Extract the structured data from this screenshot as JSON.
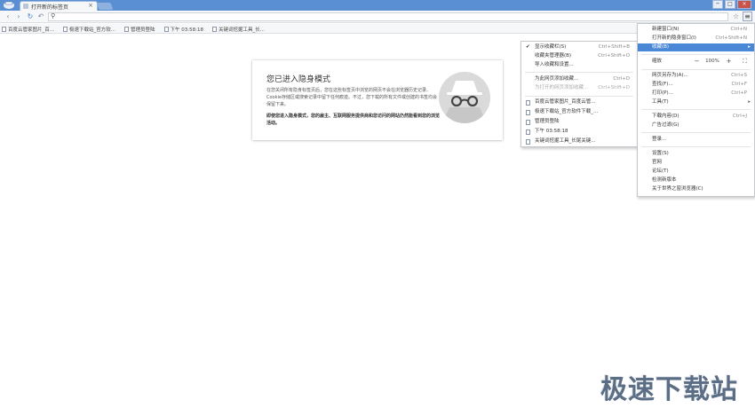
{
  "window": {
    "tab_title": "打开新的标签页",
    "tab_close": "×",
    "new_tab": "",
    "controls": [
      "─",
      "□",
      "×"
    ]
  },
  "toolbar": {
    "back": "‹",
    "forward": "›",
    "reload": "↻",
    "undo": "↶",
    "search_glyph": "⚲",
    "omnibox_value": "",
    "star_glyph": "☆",
    "menu_glyph": "≡"
  },
  "bookmarks_bar": [
    "百度云管家图片_百...",
    "极速下载站_官方软...",
    "管理员登陆",
    "下午 03:58:18",
    "关键词挖掘工具_长..."
  ],
  "incognito": {
    "title": "您已进入隐身模式",
    "paragraph": "在您关闭所有隐身标签页后，您在这些标签页中浏览的网页不会在浏览器历史记录、Cookie存储区或搜索记录中留下任何痕迹。不过，您下载的所有文件或创建的书签均会保留下来。",
    "warning": "即使您进入隐身模式，您的雇主、互联网服务提供商和您访问的网站仍然能看到您的浏览活动。"
  },
  "bookmarks_menu": {
    "items": [
      {
        "label": "显示收藏栏(S)",
        "shortcut": "Ctrl+Shift+B",
        "checked": true
      },
      {
        "label": "收藏夹管理器(B)",
        "shortcut": "Ctrl+Shift+O"
      },
      {
        "label": "导入收藏和设置..."
      },
      {
        "label": "为此网页添加收藏...",
        "shortcut": "Ctrl+D"
      },
      {
        "label": "为打开的网页添加收藏...",
        "shortcut": "Ctrl+Shift+D",
        "disabled": true
      }
    ],
    "bookmarks": [
      "百度云管家图片_百度云管...",
      "极速下载站_官方软件下载_...",
      "管理员登陆",
      "下午 03:58:18",
      "关键词挖掘工具_长尾关键..."
    ],
    "check_glyph": "✔"
  },
  "main_menu": {
    "items": [
      {
        "label": "新建窗口(N)",
        "shortcut": "Ctrl+N"
      },
      {
        "label": "打开新的隐身窗口(I)",
        "shortcut": "Ctrl+Shift+N"
      },
      {
        "label": "收藏(B)",
        "arrow": "▸",
        "active": true
      }
    ],
    "zoom": {
      "label": "缩放",
      "minus": "−",
      "value": "100%",
      "plus": "+",
      "fullscreen": "⛶"
    },
    "items2": [
      {
        "label": "网页另存为(A)...",
        "shortcut": "Ctrl+S"
      },
      {
        "label": "查找(F)...",
        "shortcut": "Ctrl+F"
      },
      {
        "label": "打印(P)...",
        "shortcut": "Ctrl+P"
      },
      {
        "label": "工具(T)",
        "arrow": "▸"
      }
    ],
    "items3": [
      {
        "label": "下载内容(D)",
        "shortcut": "Ctrl+J"
      },
      {
        "label": "广告过滤(G)"
      }
    ],
    "items4": [
      {
        "label": "登录..."
      }
    ],
    "items5": [
      {
        "label": "设置(S)"
      },
      {
        "label": "官网"
      },
      {
        "label": "论坛(T)"
      },
      {
        "label": "检测新版本"
      },
      {
        "label": "关于世界之窗浏览器(C)"
      }
    ]
  },
  "watermark": "极速下载站"
}
